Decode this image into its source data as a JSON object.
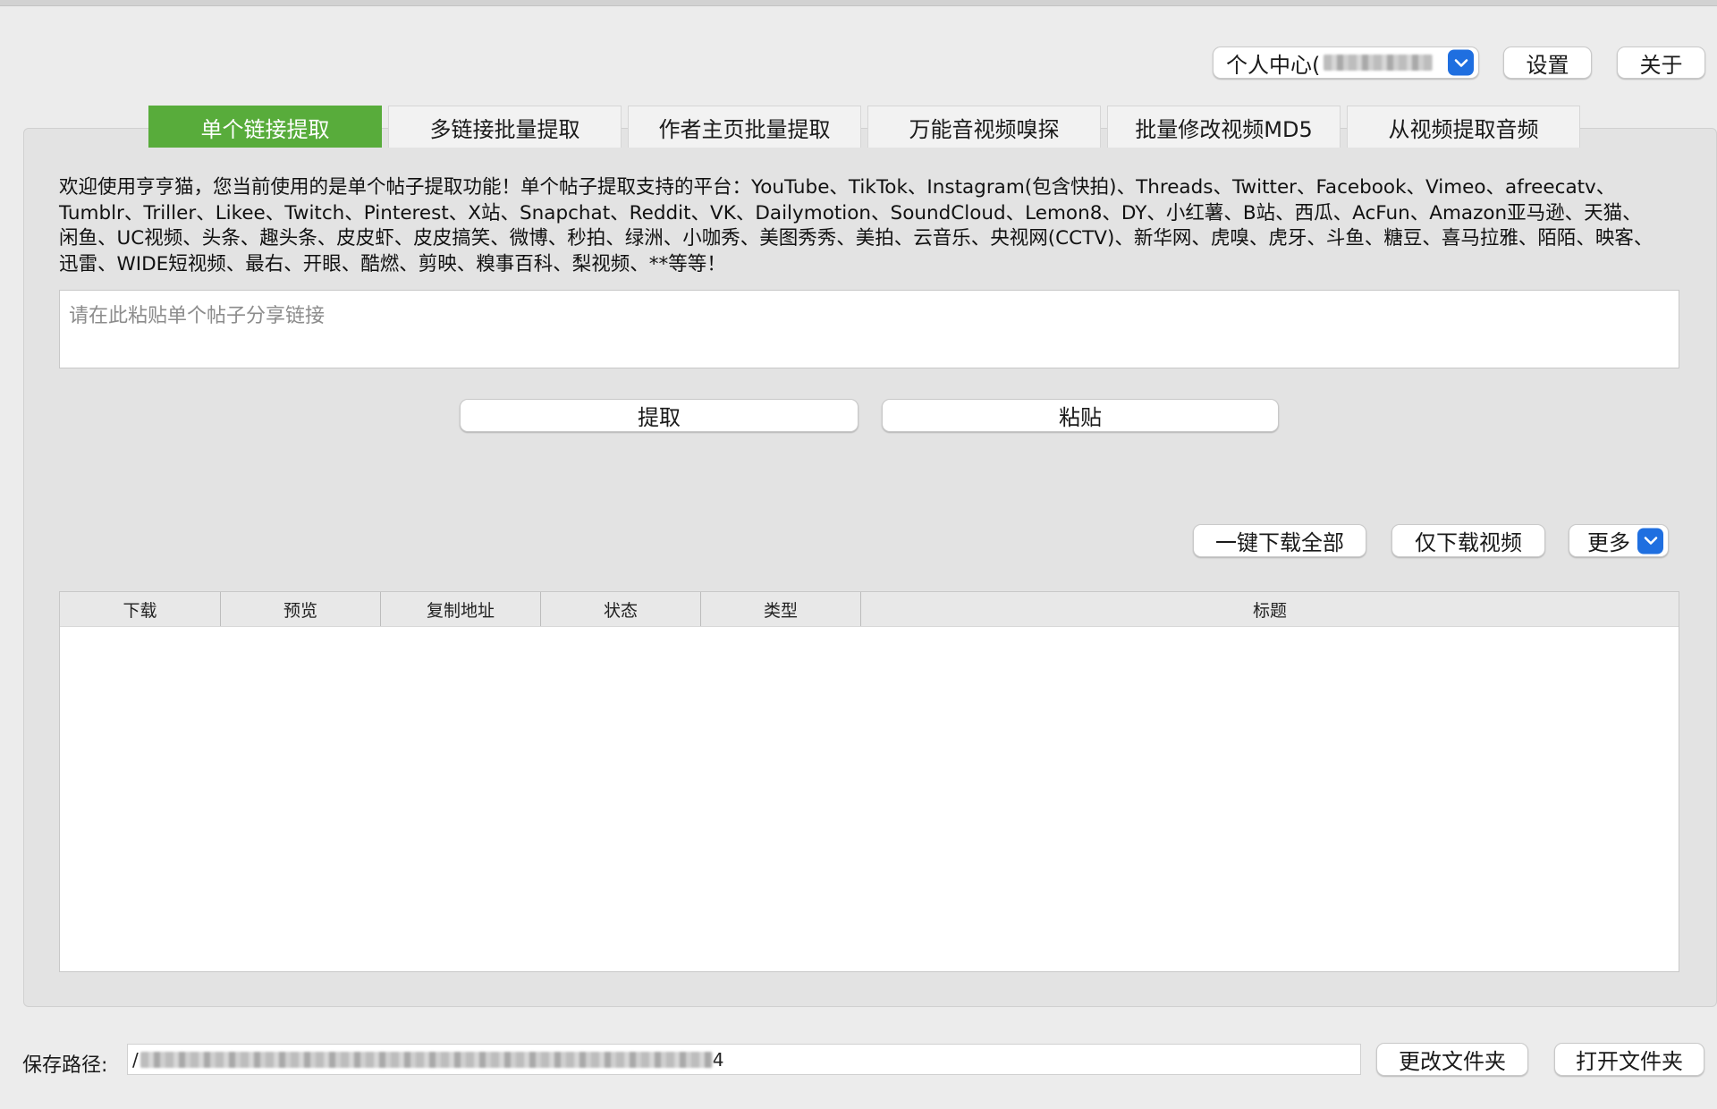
{
  "header": {
    "user_menu": {
      "label": "个人中心("
    },
    "settings_label": "设置",
    "about_label": "关于"
  },
  "tabs": [
    {
      "label": "单个链接提取",
      "active": true
    },
    {
      "label": "多链接批量提取",
      "active": false
    },
    {
      "label": "作者主页批量提取",
      "active": false
    },
    {
      "label": "万能音视频嗅探",
      "active": false
    },
    {
      "label": "批量修改视频MD5",
      "active": false
    },
    {
      "label": "从视频提取音频",
      "active": false
    }
  ],
  "description": "欢迎使用亨亨猫，您当前使用的是单个帖子提取功能！单个帖子提取支持的平台：YouTube、TikTok、Instagram(包含快拍)、Threads、Twitter、Facebook、Vimeo、afreecatv、Tumblr、Triller、Likee、Twitch、Pinterest、X站、Snapchat、Reddit、VK、Dailymotion、SoundCloud、Lemon8、DY、小红薯、B站、西瓜、AcFun、Amazon亚马逊、天猫、闲鱼、UC视频、头条、趣头条、皮皮虾、皮皮搞笑、微博、秒拍、绿洲、小咖秀、美图秀秀、美拍、云音乐、央视网(CCTV)、新华网、虎嗅、虎牙、斗鱼、糖豆、喜马拉雅、陌陌、映客、迅雷、WIDE短视频、最右、开眼、酷燃、剪映、糗事百科、梨视频、**等等！",
  "link_input": {
    "placeholder": "请在此粘贴单个帖子分享链接",
    "value": ""
  },
  "actions": {
    "extract_label": "提取",
    "paste_label": "粘贴"
  },
  "download_actions": {
    "download_all_label": "一键下载全部",
    "download_video_only_label": "仅下载视频",
    "more_label": "更多"
  },
  "table": {
    "columns": [
      "下载",
      "预览",
      "复制地址",
      "状态",
      "类型",
      "标题"
    ],
    "rows": []
  },
  "footer": {
    "save_path_label": "保存路径:",
    "save_path_visible_prefix": "/",
    "save_path_visible_suffix": "4",
    "change_folder_label": "更改文件夹",
    "open_folder_label": "打开文件夹"
  },
  "colors": {
    "active_tab": "#58ac3b",
    "select_arrow": "#1f6fe0",
    "window_bg": "#ececec"
  }
}
